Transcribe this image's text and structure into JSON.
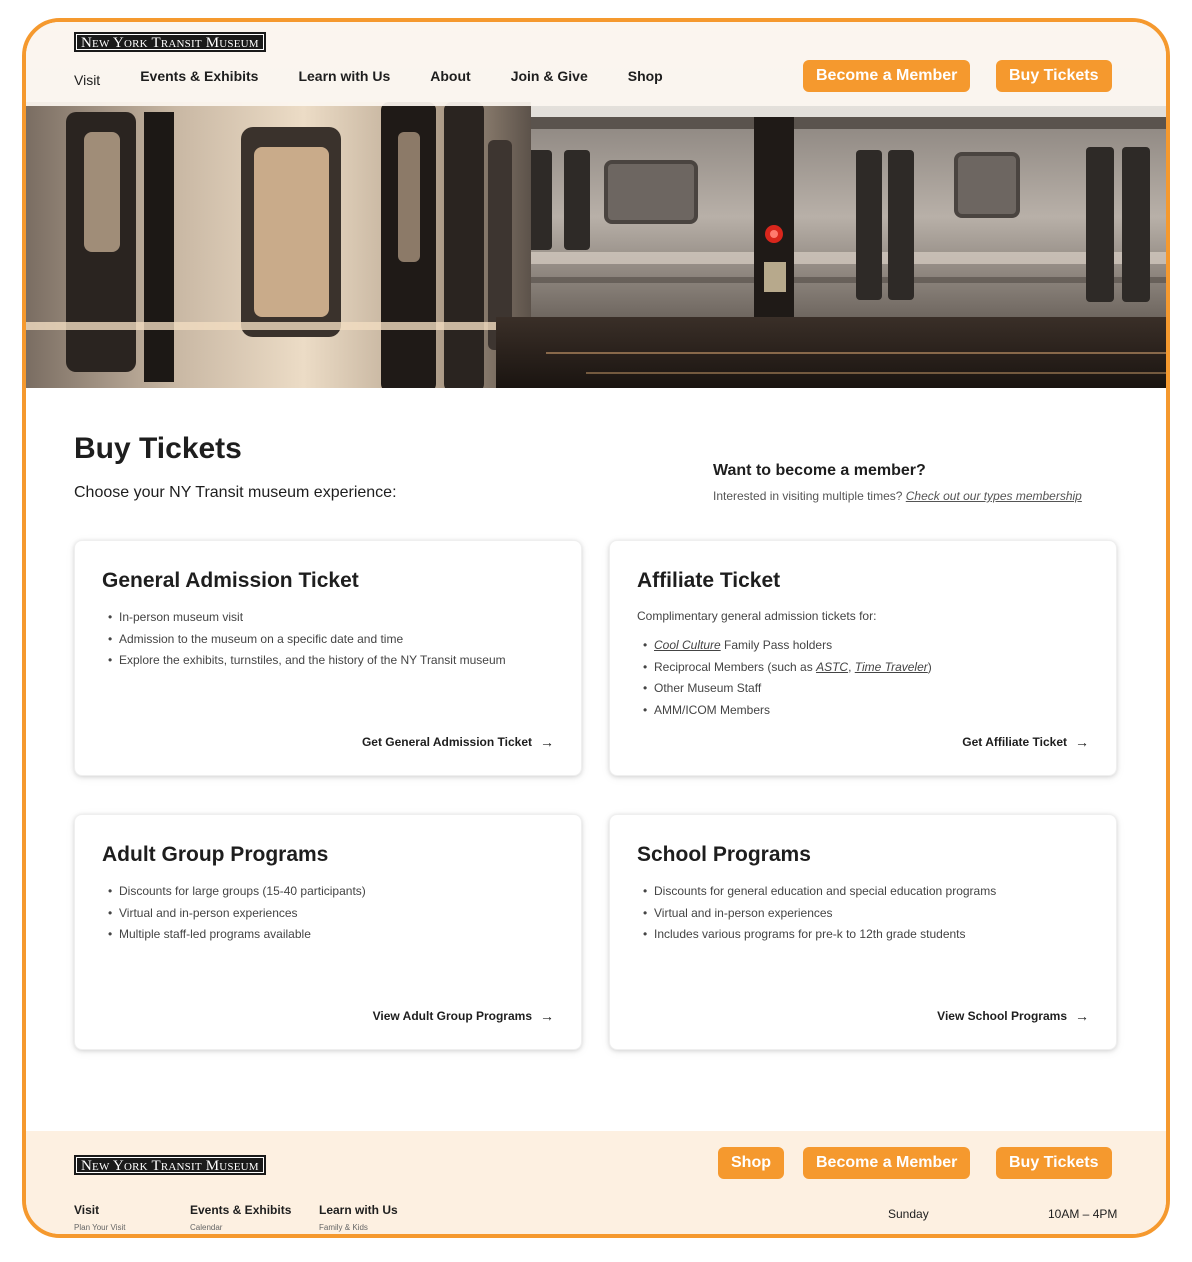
{
  "brand": {
    "logo_text": "New York Transit Museum",
    "accent": "#f5992e"
  },
  "header": {
    "nav": [
      "Visit",
      "Events & Exhibits",
      "Learn with Us",
      "About",
      "Join & Give",
      "Shop"
    ],
    "member_button": "Become a Member",
    "tickets_button": "Buy Tickets"
  },
  "main": {
    "title": "Buy Tickets",
    "subtitle": "Choose your NY Transit museum experience:",
    "member": {
      "title": "Want to become a member?",
      "text": "Interested in visiting multiple times?",
      "link": "Check out our types membership"
    }
  },
  "cards": {
    "general": {
      "title": "General Admission Ticket",
      "items": [
        "In-person museum visit",
        "Admission to the museum on a specific date and time",
        "Explore the exhibits, turnstiles, and the history of the NY Transit museum"
      ],
      "cta": "Get General Admission Ticket"
    },
    "affiliate": {
      "title": "Affiliate Ticket",
      "intro": "Complimentary general admission tickets for:",
      "item1_link": "Cool Culture",
      "item1_rest": " Family Pass holders",
      "item2_pre": "Reciprocal Members (such as ",
      "item2_link1": "ASTC",
      "item2_sep": ", ",
      "item2_link2": "Time Traveler",
      "item2_post": ")",
      "item3": "Other Museum Staff",
      "item4": "AMM/ICOM Members",
      "cta": "Get Affiliate Ticket"
    },
    "adult": {
      "title": "Adult Group Programs",
      "items": [
        "Discounts for large groups (15-40 participants)",
        "Virtual and in-person experiences",
        "Multiple staff-led programs available"
      ],
      "cta": "View Adult Group Programs"
    },
    "school": {
      "title": "School Programs",
      "items": [
        "Discounts for general education and special education programs",
        "Virtual and in-person experiences",
        "Includes various programs for pre-k to 12th grade students"
      ],
      "cta": "View School Programs"
    }
  },
  "footer": {
    "shop_button": "Shop",
    "member_button": "Become a Member",
    "tickets_button": "Buy Tickets",
    "columns": [
      {
        "heading": "Visit",
        "sub": "Plan Your Visit"
      },
      {
        "heading": "Events & Exhibits",
        "sub": "Calendar"
      },
      {
        "heading": "Learn with Us",
        "sub": "Family & Kids"
      }
    ],
    "hours": {
      "day": "Sunday",
      "time": "10AM – 4PM"
    }
  },
  "icons": {
    "arrow": "arrow-right-icon"
  }
}
